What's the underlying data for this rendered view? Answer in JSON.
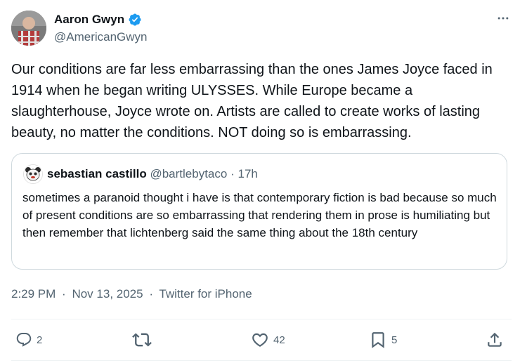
{
  "author": {
    "name": "Aaron Gwyn",
    "handle": "@AmericanGwyn",
    "verified": true
  },
  "post": {
    "text": "Our conditions are far less embarrassing than the ones James Joyce faced in 1914 when he began writing ULYSSES. While Europe became a slaughterhouse, Joyce wrote on. Artists are called to create works of lasting beauty, no matter the conditions. NOT doing so is embarrassing."
  },
  "quote": {
    "name": "sebastian castillo",
    "handle": "@bartlebytaco",
    "separator": "·",
    "time": "17h",
    "text": "sometimes a paranoid thought i have is that contemporary fiction is bad because so much of present conditions are so embarrassing that rendering them in prose is humiliating but then remember that lichtenberg said the same thing about the 18th century"
  },
  "meta": {
    "time": "2:29 PM",
    "separator": "·",
    "date": "Nov 13, 2025",
    "source": "Twitter for iPhone"
  },
  "actions": {
    "reply_count": "2",
    "repost_count": "",
    "like_count": "42",
    "bookmark_count": "5"
  },
  "icons": {
    "more": "more-horizontal-icon",
    "verified": "verified-badge-icon",
    "reply": "reply-icon",
    "repost": "repost-icon",
    "like": "heart-icon",
    "bookmark": "bookmark-icon",
    "share": "share-icon"
  },
  "colors": {
    "verified": "#1d9bf0",
    "text": "#0f1419",
    "secondary": "#536471",
    "border": "#cfd9de"
  }
}
